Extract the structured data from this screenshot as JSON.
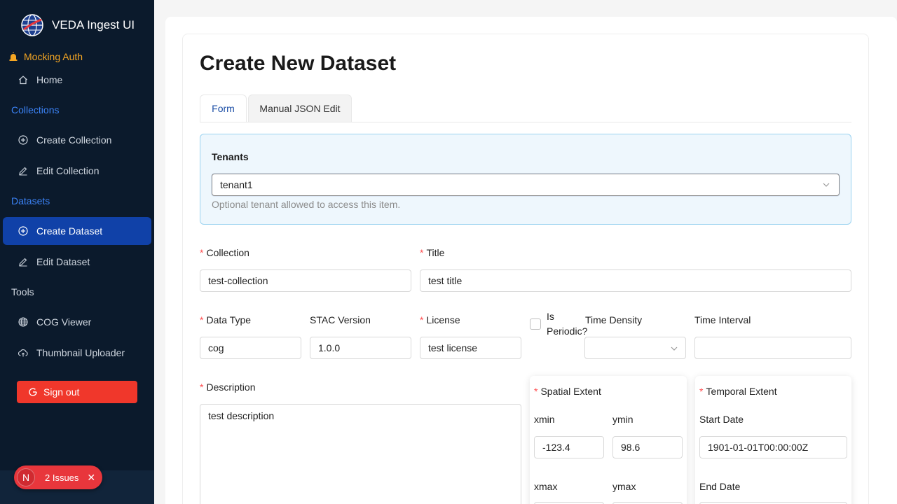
{
  "app": {
    "title": "VEDA Ingest UI",
    "auth_status": "Mocking Auth"
  },
  "sidebar": {
    "home": "Home",
    "collections_label": "Collections",
    "create_collection": "Create Collection",
    "edit_collection": "Edit Collection",
    "datasets_label": "Datasets",
    "create_dataset": "Create Dataset",
    "edit_dataset": "Edit Dataset",
    "tools_label": "Tools",
    "cog_viewer": "COG Viewer",
    "thumbnail_uploader": "Thumbnail Uploader",
    "sign_out": "Sign out",
    "active_item": "Create Dataset"
  },
  "issues_badge": {
    "avatar": "N",
    "label": "2 Issues"
  },
  "page": {
    "title": "Create New Dataset"
  },
  "tabs": [
    {
      "label": "Form",
      "active": true
    },
    {
      "label": "Manual JSON Edit",
      "active": false
    }
  ],
  "tenants": {
    "label": "Tenants",
    "value": "tenant1",
    "help": "Optional tenant allowed to access this item."
  },
  "form": {
    "collection": {
      "label": "Collection",
      "value": "test-collection",
      "required": true
    },
    "title": {
      "label": "Title",
      "value": "test title",
      "required": true
    },
    "data_type": {
      "label": "Data Type",
      "value": "cog",
      "required": true
    },
    "stac_version": {
      "label": "STAC Version",
      "value": "1.0.0"
    },
    "license": {
      "label": "License",
      "value": "test license",
      "required": true
    },
    "is_periodic": {
      "label": "Is Periodic?",
      "checked": false
    },
    "time_density": {
      "label": "Time Density",
      "value": ""
    },
    "time_interval": {
      "label": "Time Interval",
      "value": ""
    },
    "description": {
      "label": "Description",
      "value": "test description",
      "required": true
    },
    "spatial_extent": {
      "label": "Spatial Extent",
      "xmin_label": "xmin",
      "xmin": "-123.4",
      "ymin_label": "ymin",
      "ymin": "98.6",
      "xmax_label": "xmax",
      "ymax_label": "ymax"
    },
    "temporal_extent": {
      "label": "Temporal Extent",
      "start_label": "Start Date",
      "start": "1901-01-01T00:00:00Z",
      "end_label": "End Date"
    }
  },
  "colors": {
    "sidebar_bg": "#0b1a2c",
    "active_nav": "#1041a8",
    "accent_blue": "#3b82f6",
    "sign_out": "#f0372b",
    "required": "#ff4d4f",
    "auth_warning": "#f5a623"
  }
}
